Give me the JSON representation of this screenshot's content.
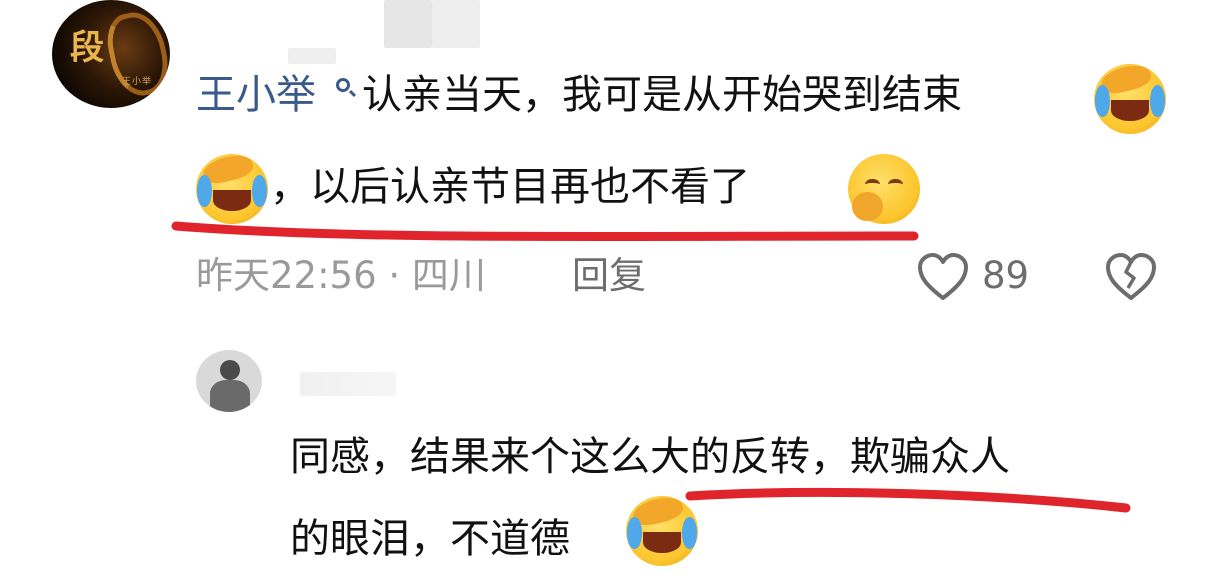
{
  "comment": {
    "avatar_glyph": "段",
    "avatar_subtext": "王小举",
    "username": "王小举",
    "search_icon": "search-icon",
    "text_line1": "认亲当天，我可是从开始哭到结束",
    "text_line2": "，以后认亲节目再也不看了",
    "meta": "昨天22:56 · 四川",
    "reply_label": "回复",
    "like_count": "89",
    "like_icon": "heart-outline-icon",
    "dislike_icon": "broken-heart-outline-icon"
  },
  "reply": {
    "avatar_icon": "person-avatar",
    "text_line1": "同感，结果来个这么大的反转，欺骗众人",
    "text_line2": "的眼泪，不道德"
  },
  "colors": {
    "username": "#3a5a8c",
    "text": "#111111",
    "meta": "#9a9a9a",
    "underline": "#e0242b"
  }
}
